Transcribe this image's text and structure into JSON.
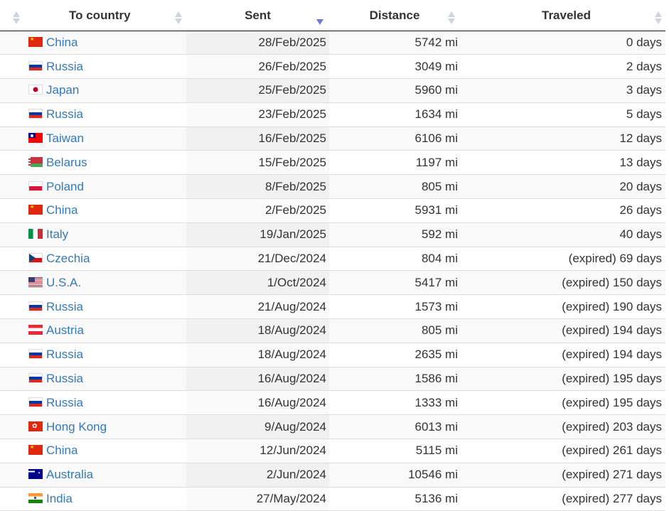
{
  "table": {
    "headers": {
      "country": "To country",
      "sent": "Sent",
      "distance": "Distance",
      "traveled": "Traveled"
    },
    "rows": [
      {
        "flag": "china-flag",
        "country": "China",
        "sent": "28/Feb/2025",
        "distance": "5742 mi",
        "traveled": "0 days"
      },
      {
        "flag": "russia-flag",
        "country": "Russia",
        "sent": "26/Feb/2025",
        "distance": "3049 mi",
        "traveled": "2 days"
      },
      {
        "flag": "japan-flag",
        "country": "Japan",
        "sent": "25/Feb/2025",
        "distance": "5960 mi",
        "traveled": "3 days"
      },
      {
        "flag": "russia-flag",
        "country": "Russia",
        "sent": "23/Feb/2025",
        "distance": "1634 mi",
        "traveled": "5 days"
      },
      {
        "flag": "taiwan-flag",
        "country": "Taiwan",
        "sent": "16/Feb/2025",
        "distance": "6106 mi",
        "traveled": "12 days"
      },
      {
        "flag": "belarus-flag",
        "country": "Belarus",
        "sent": "15/Feb/2025",
        "distance": "1197 mi",
        "traveled": "13 days"
      },
      {
        "flag": "poland-flag",
        "country": "Poland",
        "sent": "8/Feb/2025",
        "distance": "805 mi",
        "traveled": "20 days"
      },
      {
        "flag": "china-flag",
        "country": "China",
        "sent": "2/Feb/2025",
        "distance": "5931 mi",
        "traveled": "26 days"
      },
      {
        "flag": "italy-flag",
        "country": "Italy",
        "sent": "19/Jan/2025",
        "distance": "592 mi",
        "traveled": "40 days"
      },
      {
        "flag": "czechia-flag",
        "country": "Czechia",
        "sent": "21/Dec/2024",
        "distance": "804 mi",
        "traveled": "(expired) 69 days"
      },
      {
        "flag": "usa-flag",
        "country": "U.S.A.",
        "sent": "1/Oct/2024",
        "distance": "5417 mi",
        "traveled": "(expired) 150 days"
      },
      {
        "flag": "russia-flag",
        "country": "Russia",
        "sent": "21/Aug/2024",
        "distance": "1573 mi",
        "traveled": "(expired) 190 days"
      },
      {
        "flag": "austria-flag",
        "country": "Austria",
        "sent": "18/Aug/2024",
        "distance": "805 mi",
        "traveled": "(expired) 194 days"
      },
      {
        "flag": "russia-flag",
        "country": "Russia",
        "sent": "18/Aug/2024",
        "distance": "2635 mi",
        "traveled": "(expired) 194 days"
      },
      {
        "flag": "russia-flag",
        "country": "Russia",
        "sent": "16/Aug/2024",
        "distance": "1586 mi",
        "traveled": "(expired) 195 days"
      },
      {
        "flag": "russia-flag",
        "country": "Russia",
        "sent": "16/Aug/2024",
        "distance": "1333 mi",
        "traveled": "(expired) 195 days"
      },
      {
        "flag": "hongkong-flag",
        "country": "Hong Kong",
        "sent": "9/Aug/2024",
        "distance": "6013 mi",
        "traveled": "(expired) 203 days"
      },
      {
        "flag": "china-flag",
        "country": "China",
        "sent": "12/Jun/2024",
        "distance": "5115 mi",
        "traveled": "(expired) 261 days"
      },
      {
        "flag": "australia-flag",
        "country": "Australia",
        "sent": "2/Jun/2024",
        "distance": "10546 mi",
        "traveled": "(expired) 271 days"
      },
      {
        "flag": "india-flag",
        "country": "India",
        "sent": "27/May/2024",
        "distance": "5136 mi",
        "traveled": "(expired) 277 days"
      }
    ]
  },
  "colors": {
    "link": "#337ab7",
    "active_sort": "#7078d6",
    "inactive_sort": "#d0d4dc"
  }
}
